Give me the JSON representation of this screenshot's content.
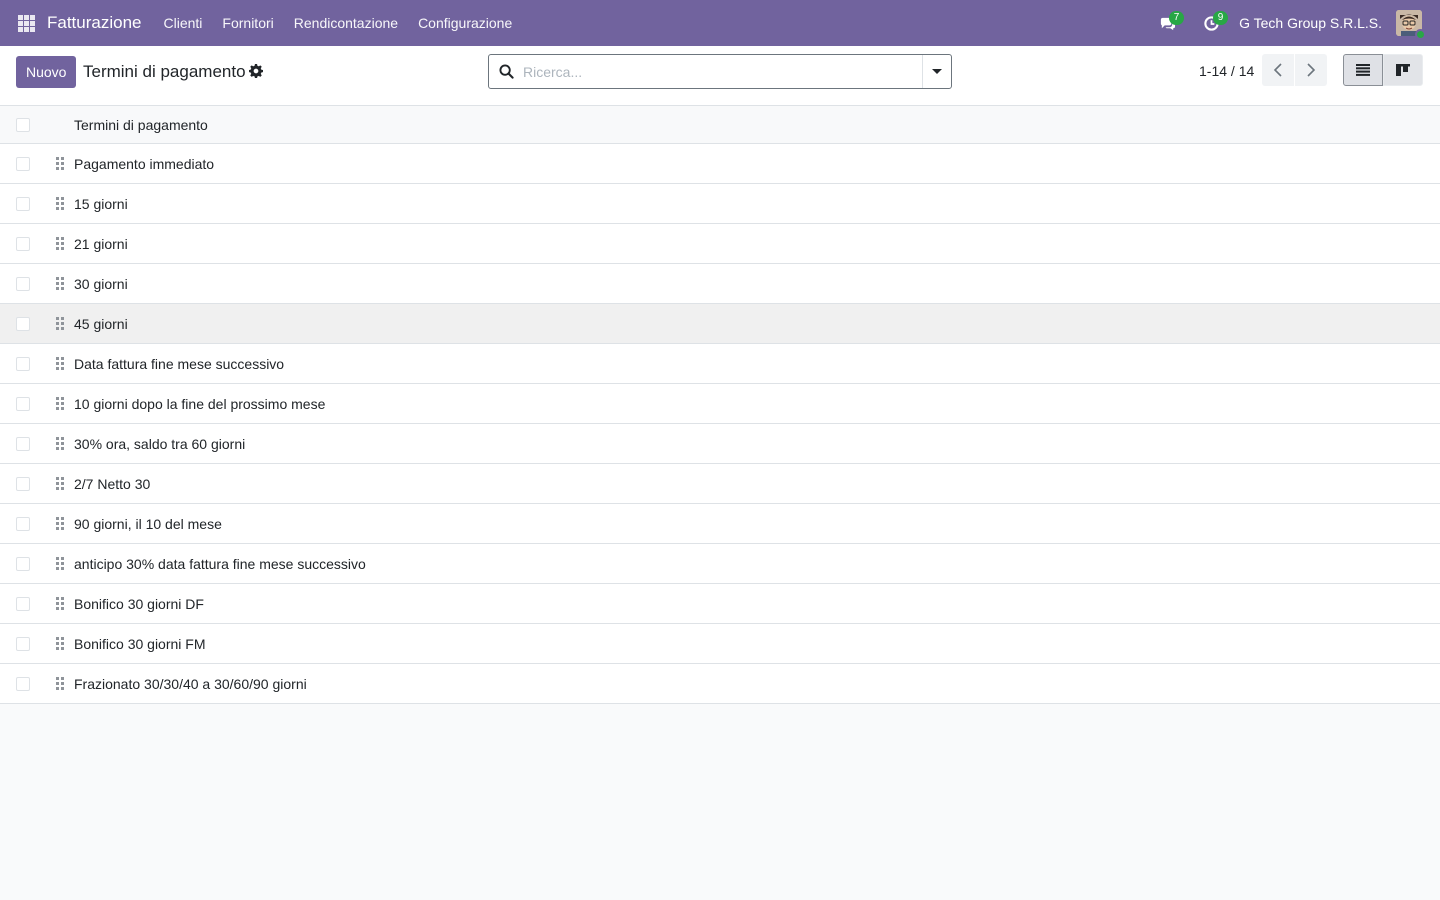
{
  "navbar": {
    "app_name": "Fatturazione",
    "menu": [
      "Clienti",
      "Fornitori",
      "Rendicontazione",
      "Configurazione"
    ],
    "messages_count": "7",
    "activities_count": "9",
    "company": "G Tech Group S.R.L.S.",
    "icons": {
      "apps": "apps-grid-icon",
      "messages": "chat-bubbles-icon",
      "activities": "clock-icon"
    },
    "colors": {
      "navbar": "#71639e",
      "badge": "#28a745",
      "online": "#28a745"
    }
  },
  "control_panel": {
    "new_label": "Nuovo",
    "title": "Termini di pagamento",
    "search_placeholder": "Ricerca...",
    "pager": "1-14 / 14",
    "views": [
      "list-view-icon",
      "kanban-view-icon"
    ]
  },
  "list": {
    "header": "Termini di pagamento",
    "rows": [
      "Pagamento immediato",
      "15 giorni",
      "21 giorni",
      "30 giorni",
      "45 giorni",
      "Data fattura fine mese successivo",
      "10 giorni dopo la fine del prossimo mese",
      "30% ora, saldo tra 60 giorni",
      "2/7 Netto 30",
      "90 giorni, il 10 del mese",
      "anticipo 30% data fattura fine mese successivo",
      "Bonifico 30 giorni DF",
      "Bonifico 30 giorni FM",
      "Frazionato 30/30/40 a 30/60/90 giorni"
    ]
  }
}
